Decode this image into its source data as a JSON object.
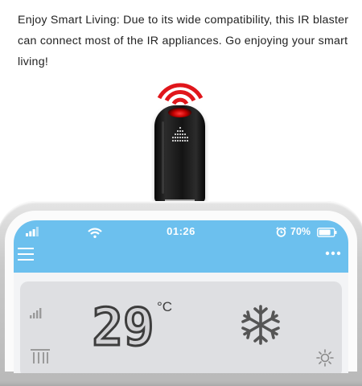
{
  "caption": {
    "text": "Enjoy Smart Living: Due to its wide compatibility, this IR blaster can connect most of the IR appliances. Go enjoying your smart living!"
  },
  "phone": {
    "status_bar": {
      "time": "01:26",
      "battery_percent": "70%"
    },
    "ac_panel": {
      "temperature": "29",
      "unit": "°C",
      "mode_icon": "snowflake-icon"
    }
  },
  "colors": {
    "app_header": "#6cc0ee",
    "ir_signal": "#e0161b",
    "device_body": "#161616",
    "panel": "#dedfe2"
  }
}
